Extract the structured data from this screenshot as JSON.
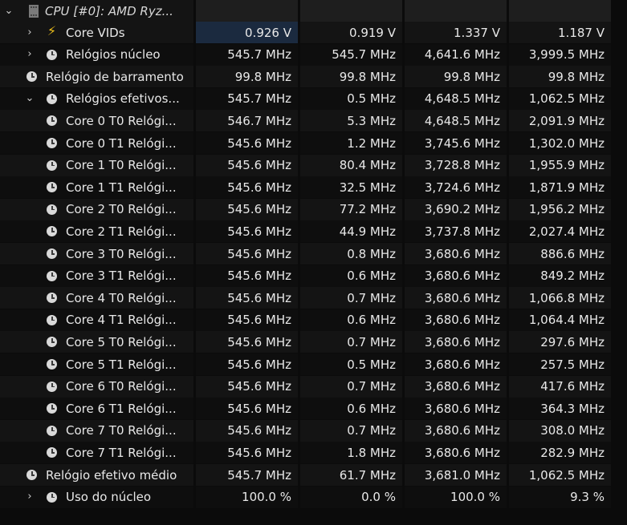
{
  "header": {
    "label": "CPU [#0]: AMD Ryz..."
  },
  "rows": [
    {
      "label": "Core VIDs",
      "icon": "bolt-icon",
      "chevron": "›",
      "values": [
        "0.926 V",
        "0.919 V",
        "1.337 V",
        "1.187 V"
      ]
    },
    {
      "label": "Relógios núcleo",
      "icon": "clock-icon",
      "chevron": "›",
      "values": [
        "545.7 MHz",
        "545.7 MHz",
        "4,641.6 MHz",
        "3,999.5 MHz"
      ]
    },
    {
      "label": "Relógio de barramento",
      "icon": "clock-icon",
      "chevron": "",
      "values": [
        "99.8 MHz",
        "99.8 MHz",
        "99.8 MHz",
        "99.8 MHz"
      ]
    },
    {
      "label": "Relógios efetivos...",
      "icon": "clock-icon",
      "chevron": "⌄",
      "values": [
        "545.7 MHz",
        "0.5 MHz",
        "4,648.5 MHz",
        "1,062.5 MHz"
      ]
    },
    {
      "label": "Core 0 T0 Relógi...",
      "icon": "clock-icon",
      "chevron": "",
      "values": [
        "546.7 MHz",
        "5.3 MHz",
        "4,648.5 MHz",
        "2,091.9 MHz"
      ]
    },
    {
      "label": "Core 0 T1 Relógi...",
      "icon": "clock-icon",
      "chevron": "",
      "values": [
        "545.6 MHz",
        "1.2 MHz",
        "3,745.6 MHz",
        "1,302.0 MHz"
      ]
    },
    {
      "label": "Core 1 T0 Relógi...",
      "icon": "clock-icon",
      "chevron": "",
      "values": [
        "545.6 MHz",
        "80.4 MHz",
        "3,728.8 MHz",
        "1,955.9 MHz"
      ]
    },
    {
      "label": "Core 1 T1 Relógi...",
      "icon": "clock-icon",
      "chevron": "",
      "values": [
        "545.6 MHz",
        "32.5 MHz",
        "3,724.6 MHz",
        "1,871.9 MHz"
      ]
    },
    {
      "label": "Core 2 T0 Relógi...",
      "icon": "clock-icon",
      "chevron": "",
      "values": [
        "545.6 MHz",
        "77.2 MHz",
        "3,690.2 MHz",
        "1,956.2 MHz"
      ]
    },
    {
      "label": "Core 2 T1 Relógi...",
      "icon": "clock-icon",
      "chevron": "",
      "values": [
        "545.6 MHz",
        "44.9 MHz",
        "3,737.8 MHz",
        "2,027.4 MHz"
      ]
    },
    {
      "label": "Core 3 T0 Relógi...",
      "icon": "clock-icon",
      "chevron": "",
      "values": [
        "545.6 MHz",
        "0.8 MHz",
        "3,680.6 MHz",
        "886.6 MHz"
      ]
    },
    {
      "label": "Core 3 T1 Relógi...",
      "icon": "clock-icon",
      "chevron": "",
      "values": [
        "545.6 MHz",
        "0.6 MHz",
        "3,680.6 MHz",
        "849.2 MHz"
      ]
    },
    {
      "label": "Core 4 T0 Relógi...",
      "icon": "clock-icon",
      "chevron": "",
      "values": [
        "545.6 MHz",
        "0.7 MHz",
        "3,680.6 MHz",
        "1,066.8 MHz"
      ]
    },
    {
      "label": "Core 4 T1 Relógi...",
      "icon": "clock-icon",
      "chevron": "",
      "values": [
        "545.6 MHz",
        "0.6 MHz",
        "3,680.6 MHz",
        "1,064.4 MHz"
      ]
    },
    {
      "label": "Core 5 T0 Relógi...",
      "icon": "clock-icon",
      "chevron": "",
      "values": [
        "545.6 MHz",
        "0.7 MHz",
        "3,680.6 MHz",
        "297.6 MHz"
      ]
    },
    {
      "label": "Core 5 T1 Relógi...",
      "icon": "clock-icon",
      "chevron": "",
      "values": [
        "545.6 MHz",
        "0.5 MHz",
        "3,680.6 MHz",
        "257.5 MHz"
      ]
    },
    {
      "label": "Core 6 T0 Relógi...",
      "icon": "clock-icon",
      "chevron": "",
      "values": [
        "545.6 MHz",
        "0.7 MHz",
        "3,680.6 MHz",
        "417.6 MHz"
      ]
    },
    {
      "label": "Core 6 T1 Relógi...",
      "icon": "clock-icon",
      "chevron": "",
      "values": [
        "545.6 MHz",
        "0.6 MHz",
        "3,680.6 MHz",
        "364.3 MHz"
      ]
    },
    {
      "label": "Core 7 T0 Relógi...",
      "icon": "clock-icon",
      "chevron": "",
      "values": [
        "545.6 MHz",
        "0.7 MHz",
        "3,680.6 MHz",
        "308.0 MHz"
      ]
    },
    {
      "label": "Core 7 T1 Relógi...",
      "icon": "clock-icon",
      "chevron": "",
      "values": [
        "545.6 MHz",
        "1.8 MHz",
        "3,680.6 MHz",
        "282.9 MHz"
      ]
    },
    {
      "label": "Relógio efetivo médio",
      "icon": "clock-icon",
      "chevron": "",
      "values": [
        "545.7 MHz",
        "61.7 MHz",
        "3,681.0 MHz",
        "1,062.5 MHz"
      ]
    },
    {
      "label": "Uso do núcleo",
      "icon": "clock-icon",
      "chevron": "›",
      "values": [
        "100.0 %",
        "0.0 %",
        "100.0 %",
        "9.3 %"
      ]
    }
  ]
}
